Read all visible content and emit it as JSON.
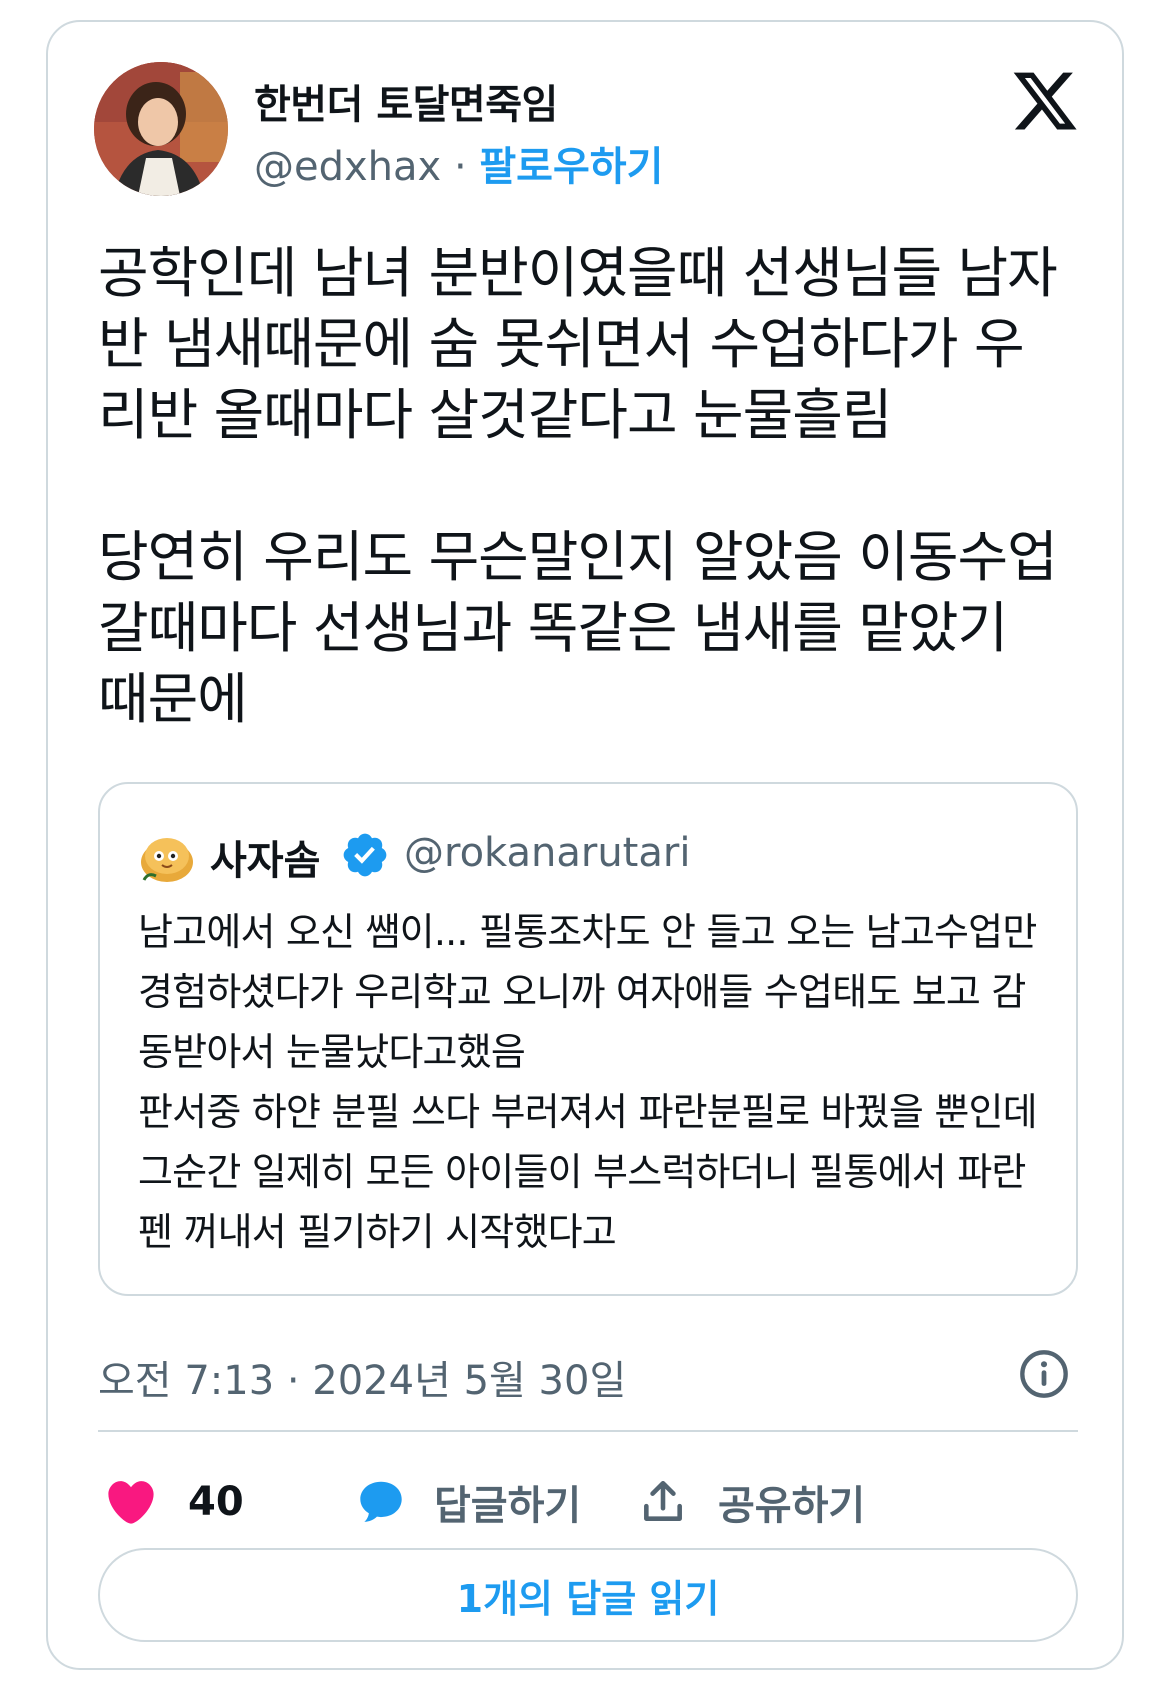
{
  "author": {
    "display_name": "한번더 토달면죽임",
    "handle": "@edxhax",
    "separator": "·",
    "follow_label": "팔로우하기"
  },
  "tweet": {
    "text": "공학인데 남녀 분반이였을때 선생님들 남자반 냄새때문에 숨 못쉬면서 수업하다가 우리반 올때마다 살것같다고 눈물흘림\n\n당연히 우리도 무슨말인지 알았음 이동수업 갈때마다 선생님과 똑같은 냄새를 맡았기 때문에"
  },
  "quote": {
    "display_name": "사자솜",
    "handle": "@rokanarutari",
    "verified": true,
    "text": "남고에서 오신 쌤이... 필통조차도 안 들고 오는 남고수업만 경험하셨다가 우리학교 오니까 여자애들 수업태도 보고 감동받아서 눈물났다고했음\n판서중 하얀 분필 쓰다 부러져서 파란분필로 바꿨을 뿐인데 그순간 일제히 모든 아이들이 부스럭하더니 필통에서 파란펜 꺼내서 필기하기 시작했다고"
  },
  "timestamp": "오전 7:13 · 2024년 5월 30일",
  "actions": {
    "like_count": "40",
    "reply_label": "답글하기",
    "share_label": "공유하기"
  },
  "read_replies_label": "1개의 답글 읽기",
  "colors": {
    "accent": "#1d9bf0",
    "like": "#f91880",
    "secondary_text": "#536471",
    "border": "#cfd9de"
  },
  "icons": [
    "x-logo-icon",
    "verified-badge-icon",
    "info-icon",
    "heart-icon",
    "reply-bubble-icon",
    "share-icon"
  ]
}
